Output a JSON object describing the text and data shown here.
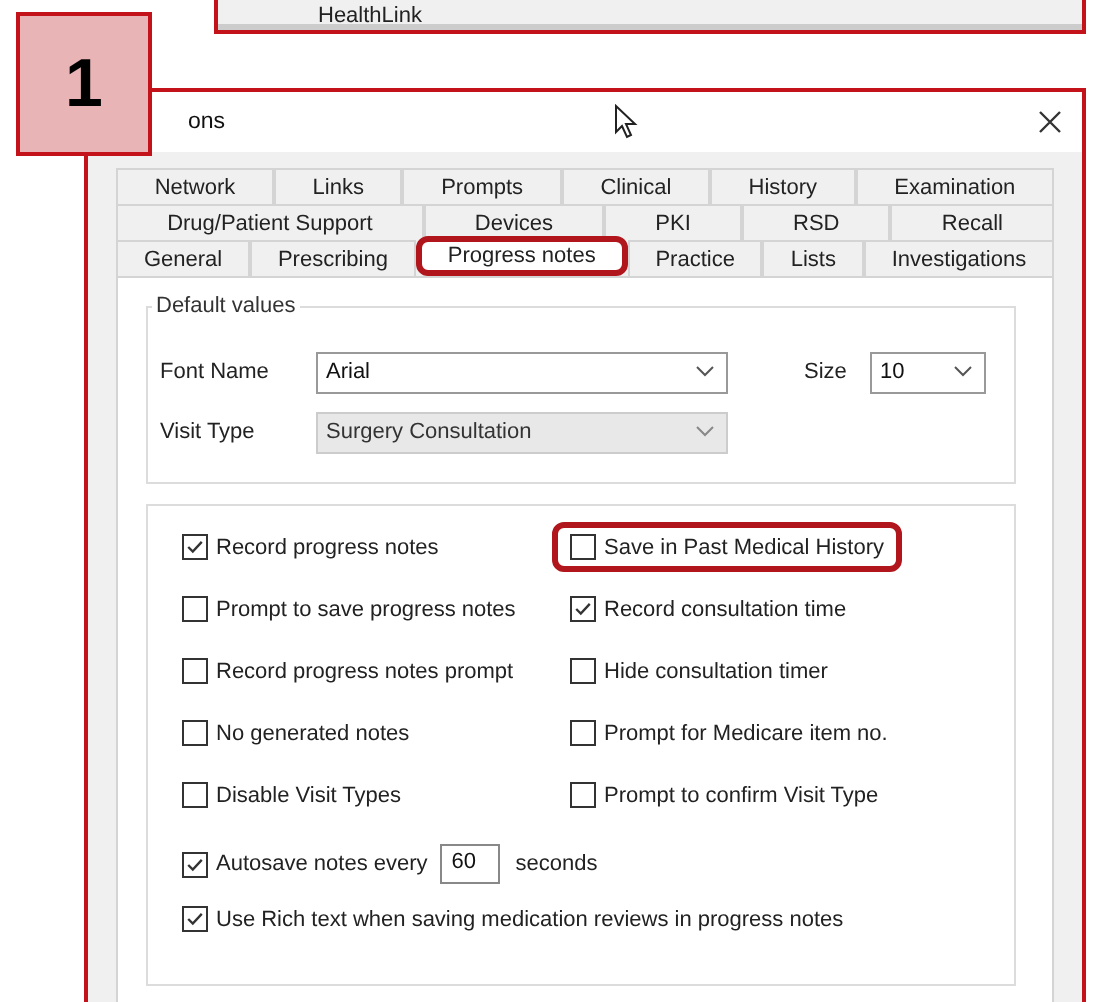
{
  "background_window": {
    "title": "HealthLink"
  },
  "badge": {
    "label": "1"
  },
  "dialog": {
    "title": "ons"
  },
  "tab_rows": [
    [
      {
        "label": "Network",
        "selected": false,
        "highlighted": false
      },
      {
        "label": "Links",
        "selected": false,
        "highlighted": false
      },
      {
        "label": "Prompts",
        "selected": false,
        "highlighted": false
      },
      {
        "label": "Clinical",
        "selected": false,
        "highlighted": false
      },
      {
        "label": "History",
        "selected": false,
        "highlighted": false
      },
      {
        "label": "Examination",
        "selected": false,
        "highlighted": false
      }
    ],
    [
      {
        "label": "Drug/Patient Support",
        "selected": false,
        "highlighted": false
      },
      {
        "label": "Devices",
        "selected": false,
        "highlighted": false
      },
      {
        "label": "PKI",
        "selected": false,
        "highlighted": false
      },
      {
        "label": "RSD",
        "selected": false,
        "highlighted": false
      },
      {
        "label": "Recall",
        "selected": false,
        "highlighted": false
      }
    ],
    [
      {
        "label": "General",
        "selected": false,
        "highlighted": false
      },
      {
        "label": "Prescribing",
        "selected": false,
        "highlighted": false
      },
      {
        "label": "Progress notes",
        "selected": true,
        "highlighted": true
      },
      {
        "label": "Practice",
        "selected": false,
        "highlighted": false
      },
      {
        "label": "Lists",
        "selected": false,
        "highlighted": false
      },
      {
        "label": "Investigations",
        "selected": false,
        "highlighted": false
      }
    ]
  ],
  "default_values": {
    "title": "Default values",
    "rows": [
      [
        {
          "label": "Font Name",
          "value": "Arial",
          "disabled": false
        },
        {
          "label": "Size",
          "value": "10",
          "disabled": false
        }
      ],
      [
        {
          "label": "Visit Type",
          "value": "Surgery Consultation",
          "disabled": true
        }
      ]
    ]
  },
  "option_rows": [
    [
      {
        "kind": "check",
        "label": "Record progress notes",
        "checked": true,
        "highlighted": false
      },
      {
        "kind": "check",
        "label": "Save in Past Medical History",
        "checked": false,
        "highlighted": true
      }
    ],
    [
      {
        "kind": "check",
        "label": "Prompt to save progress notes",
        "checked": false,
        "highlighted": false
      },
      {
        "kind": "check",
        "label": "Record consultation time",
        "checked": true,
        "highlighted": false
      }
    ],
    [
      {
        "kind": "check",
        "label": "Record progress notes prompt",
        "checked": false,
        "highlighted": false
      },
      {
        "kind": "check",
        "label": "Hide consultation timer",
        "checked": false,
        "highlighted": false
      }
    ],
    [
      {
        "kind": "check",
        "label": "No generated notes",
        "checked": false,
        "highlighted": false
      },
      {
        "kind": "check",
        "label": "Prompt for Medicare item no.",
        "checked": false,
        "highlighted": false
      }
    ],
    [
      {
        "kind": "check",
        "label": "Disable Visit Types",
        "checked": false,
        "highlighted": false
      },
      {
        "kind": "check",
        "label": "Prompt to confirm Visit Type",
        "checked": false,
        "highlighted": false
      }
    ],
    [
      {
        "kind": "interval",
        "label": "Autosave notes every",
        "value": "60",
        "suffix": "seconds",
        "checked": true,
        "highlighted": false
      }
    ],
    [
      {
        "kind": "check",
        "label": "Use Rich text when saving medication reviews in progress notes",
        "checked": true,
        "highlighted": false
      }
    ]
  ]
}
